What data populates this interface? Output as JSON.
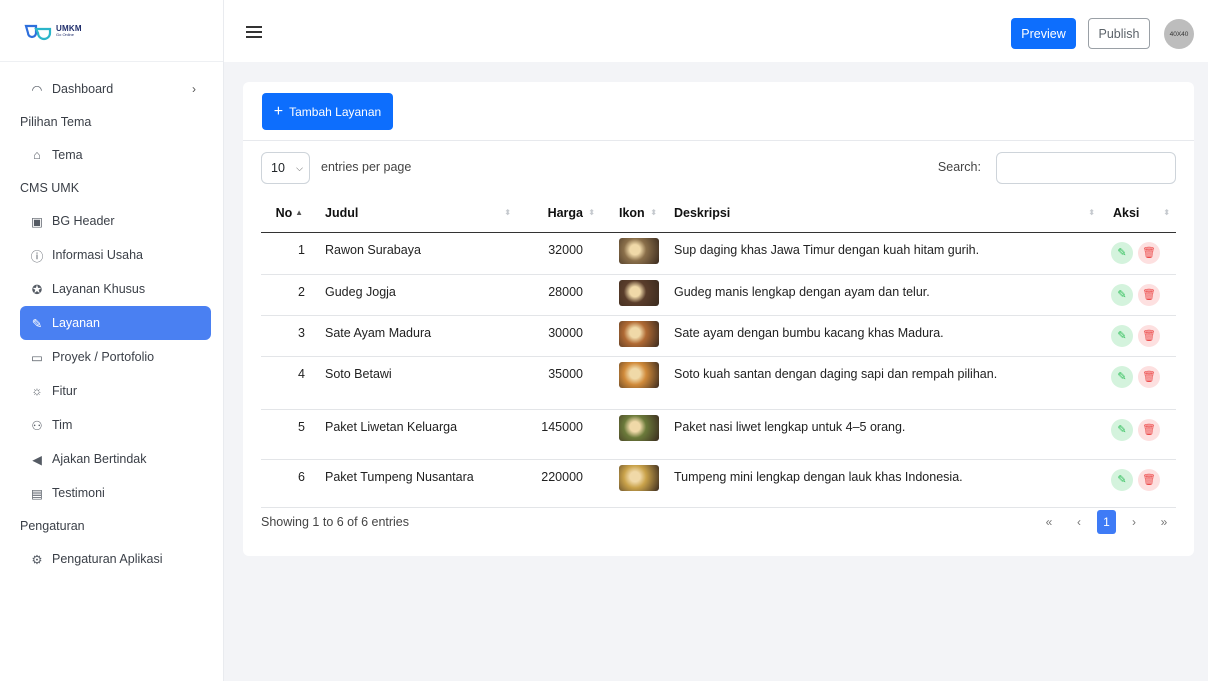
{
  "brand": {
    "name": "UMKM",
    "sub": "Go Online"
  },
  "sidebar": {
    "items": [
      {
        "type": "item",
        "label": "Dashboard",
        "icon": "dashboard-icon",
        "chevron": "›"
      },
      {
        "type": "head",
        "label": "Pilihan Tema"
      },
      {
        "type": "item",
        "label": "Tema",
        "icon": "palette-icon"
      },
      {
        "type": "head",
        "label": "CMS UMK"
      },
      {
        "type": "item",
        "label": "BG Header",
        "icon": "image-icon"
      },
      {
        "type": "item",
        "label": "Informasi Usaha",
        "icon": "info-square-icon"
      },
      {
        "type": "item",
        "label": "Layanan Khusus",
        "icon": "star-circle-icon"
      },
      {
        "type": "item",
        "label": "Layanan",
        "icon": "wrench-icon",
        "active": true
      },
      {
        "type": "item",
        "label": "Proyek / Portofolio",
        "icon": "briefcase-icon"
      },
      {
        "type": "item",
        "label": "Fitur",
        "icon": "sun-icon"
      },
      {
        "type": "item",
        "label": "Tim",
        "icon": "people-icon"
      },
      {
        "type": "item",
        "label": "Ajakan Bertindak",
        "icon": "megaphone-icon"
      },
      {
        "type": "item",
        "label": "Testimoni",
        "icon": "chat-icon"
      },
      {
        "type": "head",
        "label": "Pengaturan"
      },
      {
        "type": "item",
        "label": "Pengaturan Aplikasi",
        "icon": "gear-icon"
      }
    ]
  },
  "header": {
    "preview_label": "Preview",
    "publish_label": "Publish",
    "avatar_text": "40X40"
  },
  "toolbar": {
    "add_label": "Tambah Layanan"
  },
  "table_controls": {
    "per_page_value": "10",
    "per_page_label": "entries per page",
    "search_label": "Search:"
  },
  "table": {
    "columns": [
      "No",
      "Judul",
      "Harga",
      "Ikon",
      "Deskripsi",
      "Aksi"
    ],
    "rows": [
      {
        "no": "1",
        "judul": "Rawon Surabaya",
        "harga": "32000",
        "deskripsi": "Sup daging khas Jawa Timur dengan kuah hitam gurih.",
        "img_color": "#8a6f4a"
      },
      {
        "no": "2",
        "judul": "Gudeg Jogja",
        "harga": "28000",
        "deskripsi": "Gudeg manis lengkap dengan ayam dan telur.",
        "img_color": "#5a3d2b"
      },
      {
        "no": "3",
        "judul": "Sate Ayam Madura",
        "harga": "30000",
        "deskripsi": "Sate ayam dengan bumbu kacang khas Madura.",
        "img_color": "#b06a34"
      },
      {
        "no": "4",
        "judul": "Soto Betawi",
        "harga": "35000",
        "deskripsi": "Soto kuah santan dengan daging sapi dan rempah pilihan.",
        "img_color": "#d08a3a"
      },
      {
        "no": "5",
        "judul": "Paket Liwetan Keluarga",
        "harga": "145000",
        "deskripsi": "Paket nasi liwet lengkap untuk 4–5 orang.",
        "img_color": "#6b7a3a"
      },
      {
        "no": "6",
        "judul": "Paket Tumpeng Nusantara",
        "harga": "220000",
        "deskripsi": "Tumpeng mini lengkap dengan lauk khas Indonesia.",
        "img_color": "#c9a24a"
      }
    ]
  },
  "footer": {
    "info": "Showing 1 to 6 of 6 entries",
    "pagination": [
      "«",
      "‹",
      "1",
      "›",
      "»"
    ],
    "current_page": "1"
  }
}
